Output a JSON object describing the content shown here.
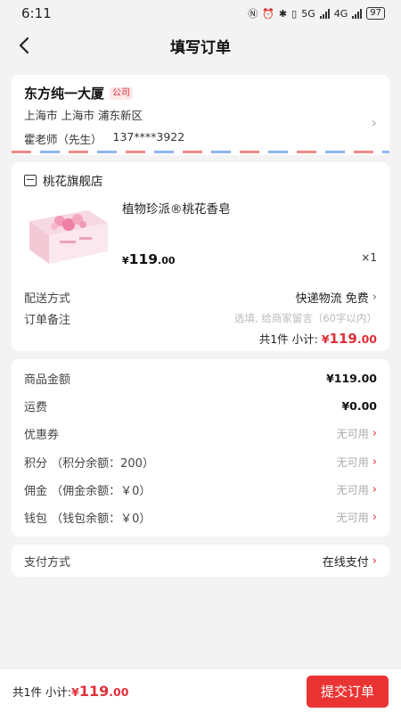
{
  "status_bar": {
    "time": "6:11",
    "signal_a": "5G",
    "signal_b": "4G",
    "battery": "97"
  },
  "nav": {
    "title": "填写订单"
  },
  "address": {
    "name": "东方纯一大厦",
    "tag": "公司",
    "region": "上海市 上海市 浦东新区",
    "contact_name": "霍老师（先生）",
    "phone": "137****3922"
  },
  "shop": {
    "name": "桃花旗舰店",
    "product": {
      "name": "植物珍派®桃花香皂",
      "price_symbol": "¥",
      "price_int": "119",
      "price_dec": ".00",
      "quantity": "×1"
    },
    "delivery_label": "配送方式",
    "delivery_value": "快递物流 免费",
    "remark_label": "订单备注",
    "remark_placeholder": "选填, 给商家留言（60字以内）",
    "subtotal_prefix": "共1件  小计:",
    "subtotal_symbol": "¥",
    "subtotal_int": "119",
    "subtotal_dec": ".00"
  },
  "amounts": [
    {
      "label": "商品金额",
      "value": "¥119.00",
      "style": "bold"
    },
    {
      "label": "运费",
      "value": "¥0.00",
      "style": "bold"
    },
    {
      "label": "优惠券",
      "value": "无可用",
      "style": "muted"
    },
    {
      "label": "积分 （积分余额：200）",
      "value": "无可用",
      "style": "muted"
    },
    {
      "label": "佣金 （佣金余额：￥0）",
      "value": "无可用",
      "style": "muted"
    },
    {
      "label": "钱包 （钱包余额：￥0）",
      "value": "无可用",
      "style": "muted"
    }
  ],
  "payment": {
    "label": "支付方式",
    "value": "在线支付"
  },
  "bottom": {
    "summary_prefix": "共1件 小计:",
    "symbol": "¥",
    "int": "119",
    "dec": ".00",
    "submit_label": "提交订单"
  },
  "colors": {
    "accent": "#ea3434",
    "price": "#e0303a",
    "background": "#f3f3f3"
  }
}
